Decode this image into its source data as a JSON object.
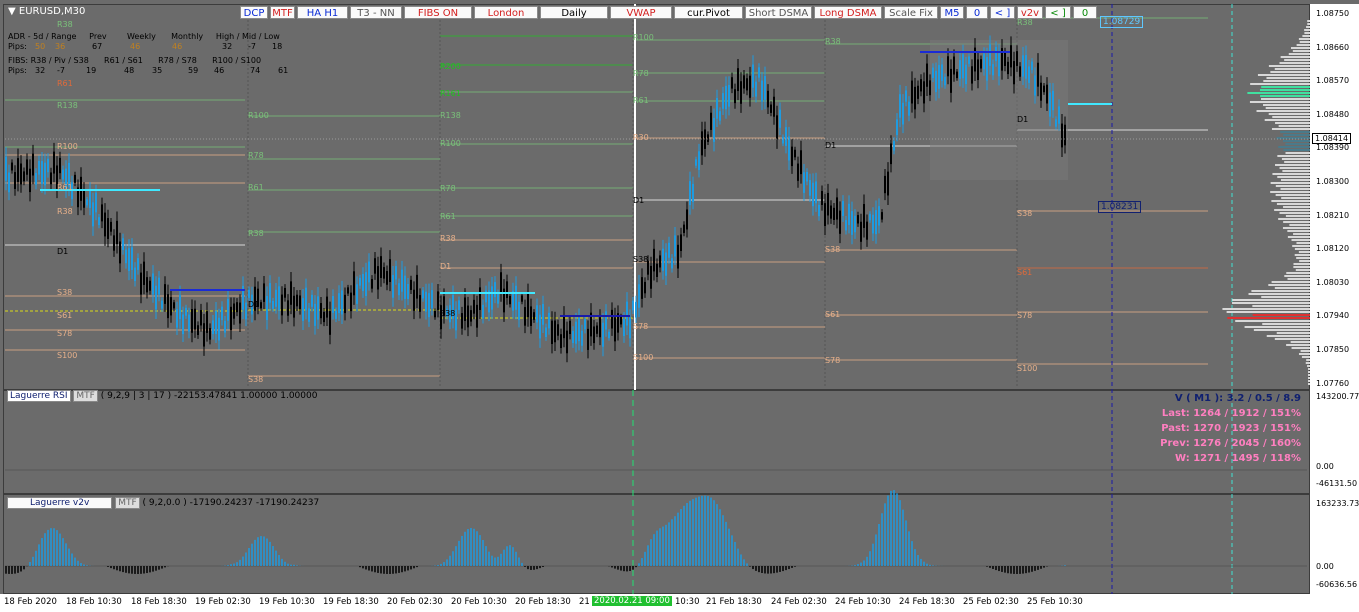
{
  "symbol": "EURUSD,M30",
  "toolbar": [
    {
      "label": "DCP",
      "color": "#0a2bd6"
    },
    {
      "label": "MTF",
      "color": "#d42020"
    },
    {
      "label": "HA H1",
      "color": "#0a2bd6"
    },
    {
      "label": "T3 - NN",
      "color": "#555555"
    },
    {
      "label": "FIBS ON",
      "color": "#d42020"
    },
    {
      "label": "London",
      "color": "#d42020"
    },
    {
      "label": "Daily",
      "color": "#000000"
    },
    {
      "label": "VWAP",
      "color": "#d42020"
    },
    {
      "label": "cur.Pivot",
      "color": "#000000"
    },
    {
      "label": "Short DSMA",
      "color": "#555555"
    },
    {
      "label": "Long DSMA",
      "color": "#d42020"
    },
    {
      "label": "Scale Fix",
      "color": "#555555"
    },
    {
      "label": "M5",
      "color": "#0a2bd6"
    },
    {
      "label": "0",
      "color": "#0a2bd6"
    },
    {
      "label": "< ]",
      "color": "#0a2bd6"
    },
    {
      "label": "v2v",
      "color": "#d42020"
    },
    {
      "label": "< ]",
      "color": "#0a8a0a"
    },
    {
      "label": "0",
      "color": "#0a8a0a"
    }
  ],
  "info_panel": {
    "row1": "ADR - 5d / Range     Prev        Weekly      Monthly     High / Mid / Low",
    "row2_label": "Pips:",
    "row2_values": [
      "50",
      "36",
      "67",
      "46",
      "46",
      "32",
      "-7",
      "18"
    ],
    "row3": "FIBS: R38 / Piv / S38      R61 / S61      R78 / S78      R100 / S100",
    "row4_label": "Pips:",
    "row4_values": [
      "32",
      "-7",
      "19",
      "48",
      "35",
      "59",
      "46",
      "74",
      "61"
    ]
  },
  "price_axis": {
    "ticks": [
      "1.08750",
      "1.08660",
      "1.08570",
      "1.08480",
      "1.08390",
      "1.08300",
      "1.08210",
      "1.08120",
      "1.08030",
      "1.07940",
      "1.07850",
      "1.07760"
    ],
    "current_price": "1.08414",
    "ask_label": "1.08729",
    "marker_label": "1.08231"
  },
  "levels": {
    "col0": [
      "R38",
      "R61",
      "R138",
      "R100",
      "R61",
      "R38",
      "D1",
      "S38",
      "S61",
      "S78",
      "S100"
    ],
    "col1": [
      "R100",
      "R78",
      "R61",
      "R38",
      "D1",
      "S38"
    ],
    "col2": [
      "R200",
      "R161",
      "R138",
      "R100",
      "R78",
      "R61",
      "R38",
      "D1",
      "S38"
    ],
    "col3": [
      "R100",
      "R78",
      "R61",
      "R30",
      "D1",
      "S38",
      "S78",
      "S100"
    ],
    "col4": [
      "R38",
      "D1",
      "S38",
      "S61",
      "S78"
    ],
    "col5": [
      "R38",
      "D1",
      "S38",
      "S61",
      "S78",
      "S100"
    ]
  },
  "laguerre_rsi": {
    "title": "Laguerre RSI",
    "mtf": "MTF",
    "params": "( 9,2,9 | 3 | 17 ) -22153.47841 1.00000 1.00000",
    "axis": [
      "143200.77",
      "0.00",
      "-46131.50"
    ],
    "stats": [
      {
        "text": "V ( M1 ): 3.2 / 0.5 / 8.9",
        "color": "#102070"
      },
      {
        "text": "Last: 1264 / 1912 / 151%",
        "color": "#ff7fc0"
      },
      {
        "text": "Past: 1270 / 1923 / 151%",
        "color": "#ff7fc0"
      },
      {
        "text": "Prev: 1276 / 2045 / 160%",
        "color": "#ff7fc0"
      },
      {
        "text": "W: 1271 / 1495 / 118%",
        "color": "#ff7fc0"
      }
    ]
  },
  "laguerre_v2v": {
    "title": "Laguerre v2v",
    "mtf": "MTF",
    "params": "( 9,2,0.0 ) -17190.24237 -17190.24237",
    "axis": [
      "163233.73",
      "0.00",
      "-60636.56"
    ]
  },
  "time_axis": [
    "18 Feb 2020",
    "18 Feb 10:30",
    "18 Feb 18:30",
    "19 Feb 02:30",
    "19 Feb 10:30",
    "19 Feb 18:30",
    "20 Feb 02:30",
    "20 Feb 10:30",
    "20 Feb 18:30",
    "21",
    "10:30",
    "21 Feb 18:30",
    "24 Feb 02:30",
    "24 Feb 10:30",
    "24 Feb 18:30",
    "25 Feb 02:30",
    "25 Feb 10:30"
  ],
  "time_highlight": "2020.02.21 09:00",
  "colors": {
    "background": "#6b6b6b",
    "bull": "#1e9be0",
    "bear": "#000000",
    "orange": "#e8623c",
    "navy": "#0b1660",
    "green": "#20e070"
  }
}
